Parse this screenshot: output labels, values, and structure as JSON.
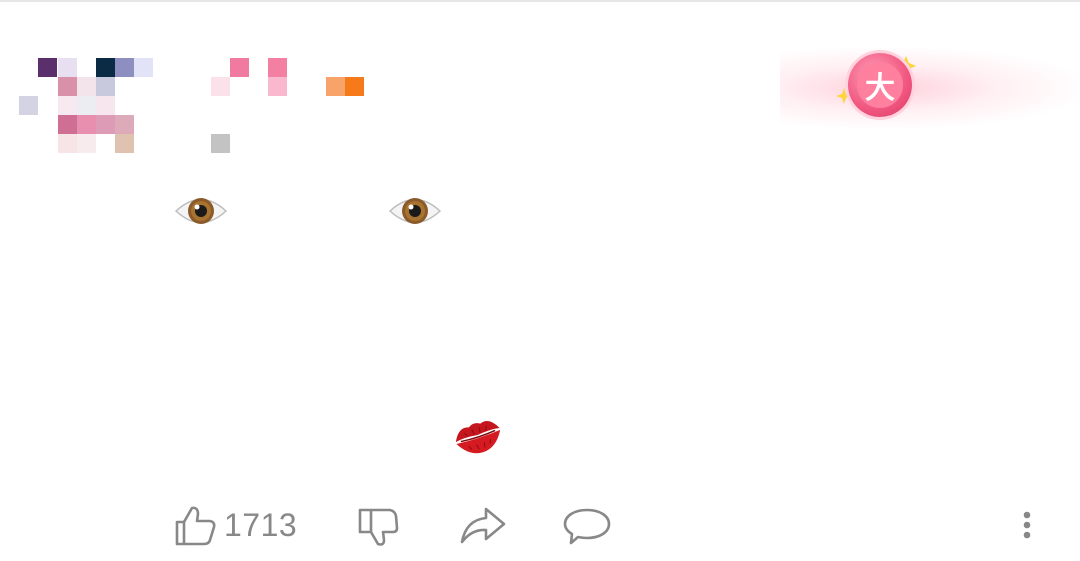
{
  "comment": {
    "author_badge": {
      "icon": "da-badge-icon",
      "text": "大",
      "color": "#f0567f"
    },
    "content": {
      "eye_left": "👁",
      "eye_right": "👁",
      "lips": "💋"
    }
  },
  "actions": {
    "like_count": "1713",
    "like_icon": "thumb-up-icon",
    "dislike_icon": "thumb-down-icon",
    "share_icon": "share-arrow-icon",
    "reply_icon": "speech-bubble-icon",
    "more_icon": "vertical-dots-icon",
    "icon_color": "#888888"
  }
}
